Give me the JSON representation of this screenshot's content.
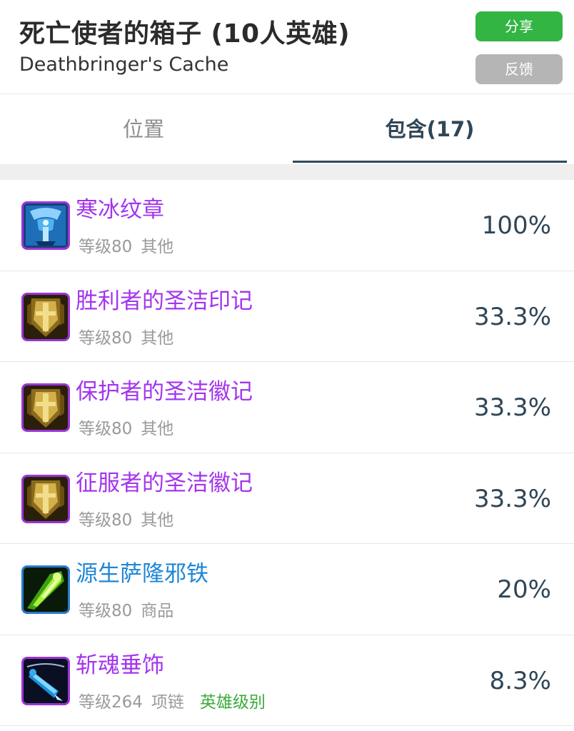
{
  "header": {
    "title": "死亡使者的箱子 (10人英雄)",
    "subtitle": "Deathbringer's Cache",
    "share_label": "分享",
    "feedback_label": "反馈"
  },
  "tabs": [
    {
      "label": "位置",
      "active": false
    },
    {
      "label": "包含(17)",
      "active": true
    }
  ],
  "items": [
    {
      "name": "寒冰纹章",
      "name_color": "#a335ee",
      "level": "等级80",
      "type": "其他",
      "extra": "",
      "chance": "100%",
      "icon": "frost-emblem-icon"
    },
    {
      "name": "胜利者的圣洁印记",
      "name_color": "#a335ee",
      "level": "等级80",
      "type": "其他",
      "extra": "",
      "chance": "33.3%",
      "icon": "sanctified-mark-icon"
    },
    {
      "name": "保护者的圣洁徽记",
      "name_color": "#a335ee",
      "level": "等级80",
      "type": "其他",
      "extra": "",
      "chance": "33.3%",
      "icon": "sanctified-mark-icon"
    },
    {
      "name": "征服者的圣洁徽记",
      "name_color": "#a335ee",
      "level": "等级80",
      "type": "其他",
      "extra": "",
      "chance": "33.3%",
      "icon": "sanctified-mark-icon"
    },
    {
      "name": "源生萨隆邪铁",
      "name_color": "#1e86d6",
      "level": "等级80",
      "type": "商品",
      "extra": "",
      "chance": "20%",
      "icon": "primordial-saronite-icon"
    },
    {
      "name": "斩魂垂饰",
      "name_color": "#a335ee",
      "level": "等级264",
      "type": "项链",
      "extra": "英雄级别",
      "chance": "8.3%",
      "icon": "soulcleave-pendant-icon"
    }
  ],
  "colors": {
    "epic": "#a335ee",
    "rare": "#1e86d6",
    "heroic_tag": "#3cab3c",
    "share_button": "#33b543",
    "feedback_button": "#b5b5b5",
    "active_tab": "#2f4657"
  }
}
